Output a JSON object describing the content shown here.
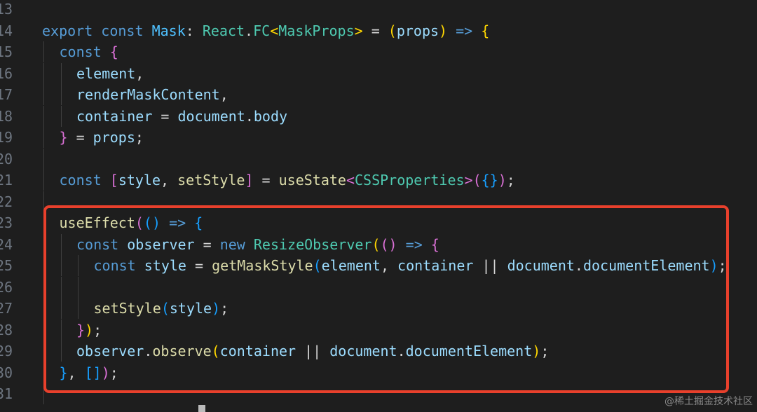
{
  "editor": {
    "lines": [
      {
        "num": "13",
        "indent": 0,
        "tokens": []
      },
      {
        "num": "14",
        "indent": 0,
        "tokens": [
          {
            "t": "export",
            "c": "kw"
          },
          {
            "t": " "
          },
          {
            "t": "const",
            "c": "kw"
          },
          {
            "t": " "
          },
          {
            "t": "Mask",
            "c": "const"
          },
          {
            "t": ": "
          },
          {
            "t": "React",
            "c": "type"
          },
          {
            "t": "."
          },
          {
            "t": "FC",
            "c": "type"
          },
          {
            "t": "<",
            "c": "b1"
          },
          {
            "t": "MaskProps",
            "c": "type"
          },
          {
            "t": ">",
            "c": "b1"
          },
          {
            "t": " = "
          },
          {
            "t": "(",
            "c": "b1"
          },
          {
            "t": "props",
            "c": "var"
          },
          {
            "t": ")",
            "c": "b1"
          },
          {
            "t": " "
          },
          {
            "t": "=>",
            "c": "kw"
          },
          {
            "t": " "
          },
          {
            "t": "{",
            "c": "b1"
          }
        ]
      },
      {
        "num": "15",
        "indent": 1,
        "tokens": [
          {
            "t": "const",
            "c": "kw"
          },
          {
            "t": " "
          },
          {
            "t": "{",
            "c": "b2"
          }
        ]
      },
      {
        "num": "16",
        "indent": 2,
        "tokens": [
          {
            "t": "element",
            "c": "var"
          },
          {
            "t": ","
          }
        ]
      },
      {
        "num": "17",
        "indent": 2,
        "tokens": [
          {
            "t": "renderMaskContent",
            "c": "var"
          },
          {
            "t": ","
          }
        ]
      },
      {
        "num": "18",
        "indent": 2,
        "tokens": [
          {
            "t": "container",
            "c": "var"
          },
          {
            "t": " = "
          },
          {
            "t": "document",
            "c": "var"
          },
          {
            "t": "."
          },
          {
            "t": "body",
            "c": "var"
          }
        ]
      },
      {
        "num": "19",
        "indent": 1,
        "tokens": [
          {
            "t": "}",
            "c": "b2"
          },
          {
            "t": " = "
          },
          {
            "t": "props",
            "c": "var"
          },
          {
            "t": ";"
          }
        ]
      },
      {
        "num": "20",
        "indent": 1,
        "tokens": []
      },
      {
        "num": "21",
        "indent": 1,
        "tokens": [
          {
            "t": "const",
            "c": "kw"
          },
          {
            "t": " "
          },
          {
            "t": "[",
            "c": "b2"
          },
          {
            "t": "style",
            "c": "var"
          },
          {
            "t": ", "
          },
          {
            "t": "setStyle",
            "c": "fn"
          },
          {
            "t": "]",
            "c": "b2"
          },
          {
            "t": " = "
          },
          {
            "t": "useState",
            "c": "fn"
          },
          {
            "t": "<",
            "c": "b2"
          },
          {
            "t": "CSSProperties",
            "c": "type"
          },
          {
            "t": ">",
            "c": "b2"
          },
          {
            "t": "(",
            "c": "b2"
          },
          {
            "t": "{}",
            "c": "b3"
          },
          {
            "t": ")",
            "c": "b2"
          },
          {
            "t": ";"
          }
        ]
      },
      {
        "num": "22",
        "indent": 1,
        "tokens": []
      },
      {
        "num": "23",
        "indent": 1,
        "tokens": [
          {
            "t": "useEffect",
            "c": "fn"
          },
          {
            "t": "(",
            "c": "b2"
          },
          {
            "t": "()",
            "c": "b3"
          },
          {
            "t": " "
          },
          {
            "t": "=>",
            "c": "kw"
          },
          {
            "t": " "
          },
          {
            "t": "{",
            "c": "b3"
          }
        ]
      },
      {
        "num": "24",
        "indent": 2,
        "tokens": [
          {
            "t": "const",
            "c": "kw"
          },
          {
            "t": " "
          },
          {
            "t": "observer",
            "c": "var"
          },
          {
            "t": " = "
          },
          {
            "t": "new",
            "c": "kw"
          },
          {
            "t": " "
          },
          {
            "t": "ResizeObserver",
            "c": "type"
          },
          {
            "t": "(",
            "c": "b1"
          },
          {
            "t": "()",
            "c": "b2"
          },
          {
            "t": " "
          },
          {
            "t": "=>",
            "c": "kw"
          },
          {
            "t": " "
          },
          {
            "t": "{",
            "c": "b2"
          }
        ]
      },
      {
        "num": "25",
        "indent": 3,
        "tokens": [
          {
            "t": "const",
            "c": "kw"
          },
          {
            "t": " "
          },
          {
            "t": "style",
            "c": "var"
          },
          {
            "t": " = "
          },
          {
            "t": "getMaskStyle",
            "c": "fn"
          },
          {
            "t": "(",
            "c": "b3"
          },
          {
            "t": "element",
            "c": "var"
          },
          {
            "t": ", "
          },
          {
            "t": "container",
            "c": "var"
          },
          {
            "t": " || "
          },
          {
            "t": "document",
            "c": "var"
          },
          {
            "t": "."
          },
          {
            "t": "documentElement",
            "c": "var"
          },
          {
            "t": ")",
            "c": "b3"
          },
          {
            "t": ";"
          }
        ]
      },
      {
        "num": "26",
        "indent": 3,
        "tokens": []
      },
      {
        "num": "27",
        "indent": 3,
        "tokens": [
          {
            "t": "setStyle",
            "c": "fn"
          },
          {
            "t": "(",
            "c": "b3"
          },
          {
            "t": "style",
            "c": "var"
          },
          {
            "t": ")",
            "c": "b3"
          },
          {
            "t": ";"
          }
        ]
      },
      {
        "num": "28",
        "indent": 2,
        "tokens": [
          {
            "t": "}",
            "c": "b2"
          },
          {
            "t": ")",
            "c": "b1"
          },
          {
            "t": ";"
          }
        ]
      },
      {
        "num": "29",
        "indent": 2,
        "tokens": [
          {
            "t": "observer",
            "c": "var"
          },
          {
            "t": "."
          },
          {
            "t": "observe",
            "c": "fn"
          },
          {
            "t": "(",
            "c": "b1"
          },
          {
            "t": "container",
            "c": "var"
          },
          {
            "t": " || "
          },
          {
            "t": "document",
            "c": "var"
          },
          {
            "t": "."
          },
          {
            "t": "documentElement",
            "c": "var"
          },
          {
            "t": ")",
            "c": "b1"
          },
          {
            "t": ";"
          }
        ]
      },
      {
        "num": "30",
        "indent": 1,
        "tokens": [
          {
            "t": "}",
            "c": "b3"
          },
          {
            "t": ", "
          },
          {
            "t": "[]",
            "c": "b3"
          },
          {
            "t": ")",
            "c": "b2"
          },
          {
            "t": ";"
          }
        ]
      },
      {
        "num": "31",
        "indent": 1,
        "tokens": []
      }
    ]
  },
  "watermark": "@稀土掘金技术社区",
  "colors": {
    "background": "#1e1e1e",
    "highlight_border": "#e8402c"
  }
}
